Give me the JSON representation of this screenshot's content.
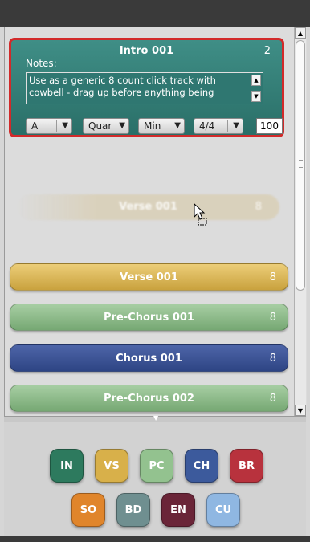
{
  "selected_section": {
    "title": "Intro 001",
    "count": "2",
    "notes_label": "Notes:",
    "notes_text": "Use as a generic 8 count click track with cowbell - drag up before anything being",
    "key_value": "A",
    "feel_value": "Quar",
    "mode_value": "Min",
    "time_signature_value": "4/4",
    "tempo_value": "100",
    "border_color": "#d22a2a",
    "color": "#2f7771"
  },
  "dragging_ghost": {
    "title": "Verse 001",
    "count": "8"
  },
  "sections": [
    {
      "title": "Verse 001",
      "count": "8",
      "color": "#d9b65a"
    },
    {
      "title": "Pre-Chorus 001",
      "count": "8",
      "color": "#8fbd8b"
    },
    {
      "title": "Chorus 001",
      "count": "8",
      "color": "#3d5596"
    },
    {
      "title": "Pre-Chorus 002",
      "count": "8",
      "color": "#8fbd8b"
    }
  ],
  "palette": {
    "row1": [
      {
        "label": "IN",
        "color": "#2d7a5e"
      },
      {
        "label": "VS",
        "color": "#d8b04a"
      },
      {
        "label": "PC",
        "color": "#93c28f"
      },
      {
        "label": "CH",
        "color": "#3c5a9c"
      },
      {
        "label": "BR",
        "color": "#b8323d"
      }
    ],
    "row2": [
      {
        "label": "SO",
        "color": "#e0852b"
      },
      {
        "label": "BD",
        "color": "#6f8f90"
      },
      {
        "label": "EN",
        "color": "#6a2538"
      },
      {
        "label": "CU",
        "color": "#8fb7e2"
      }
    ]
  },
  "icons": {
    "scroll_up": "▲",
    "scroll_down": "▼",
    "dropdown_arrow": "▼",
    "palette_collapse": "▼"
  }
}
